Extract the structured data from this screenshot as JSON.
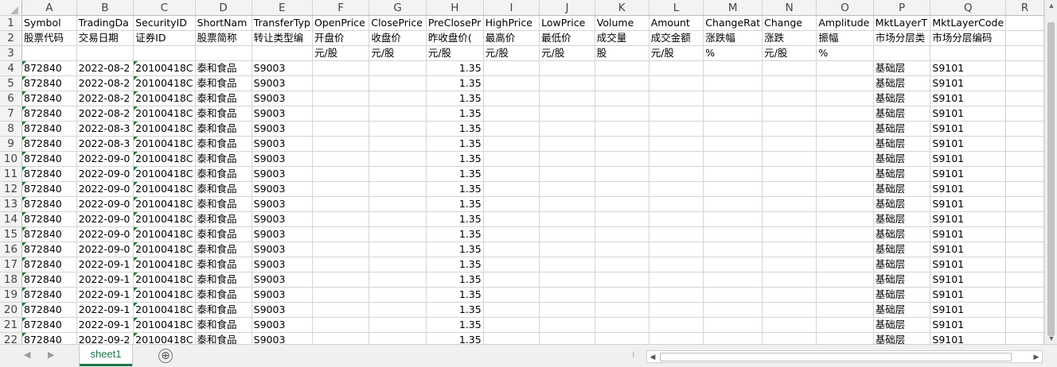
{
  "columns": [
    "A",
    "B",
    "C",
    "D",
    "E",
    "F",
    "G",
    "H",
    "I",
    "J",
    "K",
    "L",
    "M",
    "N",
    "O",
    "P",
    "Q",
    "R"
  ],
  "header_rows": [
    [
      "Symbol",
      "TradingDa",
      "SecurityID",
      "ShortNam",
      "TransferTyp",
      "OpenPrice",
      "ClosePrice",
      "PreClosePr",
      "HighPrice",
      "LowPrice",
      "Volume",
      "Amount",
      "ChangeRat",
      "Change",
      "Amplitude",
      "MktLayerT",
      "MktLayerCode",
      ""
    ],
    [
      "股票代码",
      "交易日期",
      "证券ID",
      "股票简称",
      "转让类型编",
      "开盘价",
      "收盘价",
      "昨收盘价(",
      "最高价",
      "最低价",
      "成交量",
      "成交金额",
      "涨跌幅",
      "涨跌",
      "振幅",
      "市场分层类",
      "市场分层编码",
      ""
    ],
    [
      "",
      "",
      "",
      "",
      "",
      "元/股",
      "元/股",
      "元/股",
      "元/股",
      "元/股",
      "股",
      "元/股",
      "%",
      "元/股",
      "%",
      "",
      "",
      ""
    ]
  ],
  "data_rows": [
    {
      "row": "4",
      "symbol": "872840",
      "date": "2022-08-2",
      "secid": "20100418C",
      "name": "泰和食品",
      "transfer": "S9003",
      "preclose": "1.35",
      "layer": "基础层",
      "layercode": "S9101"
    },
    {
      "row": "5",
      "symbol": "872840",
      "date": "2022-08-2",
      "secid": "20100418C",
      "name": "泰和食品",
      "transfer": "S9003",
      "preclose": "1.35",
      "layer": "基础层",
      "layercode": "S9101"
    },
    {
      "row": "6",
      "symbol": "872840",
      "date": "2022-08-2",
      "secid": "20100418C",
      "name": "泰和食品",
      "transfer": "S9003",
      "preclose": "1.35",
      "layer": "基础层",
      "layercode": "S9101"
    },
    {
      "row": "7",
      "symbol": "872840",
      "date": "2022-08-2",
      "secid": "20100418C",
      "name": "泰和食品",
      "transfer": "S9003",
      "preclose": "1.35",
      "layer": "基础层",
      "layercode": "S9101"
    },
    {
      "row": "8",
      "symbol": "872840",
      "date": "2022-08-3",
      "secid": "20100418C",
      "name": "泰和食品",
      "transfer": "S9003",
      "preclose": "1.35",
      "layer": "基础层",
      "layercode": "S9101"
    },
    {
      "row": "9",
      "symbol": "872840",
      "date": "2022-08-3",
      "secid": "20100418C",
      "name": "泰和食品",
      "transfer": "S9003",
      "preclose": "1.35",
      "layer": "基础层",
      "layercode": "S9101"
    },
    {
      "row": "10",
      "symbol": "872840",
      "date": "2022-09-0",
      "secid": "20100418C",
      "name": "泰和食品",
      "transfer": "S9003",
      "preclose": "1.35",
      "layer": "基础层",
      "layercode": "S9101"
    },
    {
      "row": "11",
      "symbol": "872840",
      "date": "2022-09-0",
      "secid": "20100418C",
      "name": "泰和食品",
      "transfer": "S9003",
      "preclose": "1.35",
      "layer": "基础层",
      "layercode": "S9101"
    },
    {
      "row": "12",
      "symbol": "872840",
      "date": "2022-09-0",
      "secid": "20100418C",
      "name": "泰和食品",
      "transfer": "S9003",
      "preclose": "1.35",
      "layer": "基础层",
      "layercode": "S9101"
    },
    {
      "row": "13",
      "symbol": "872840",
      "date": "2022-09-0",
      "secid": "20100418C",
      "name": "泰和食品",
      "transfer": "S9003",
      "preclose": "1.35",
      "layer": "基础层",
      "layercode": "S9101"
    },
    {
      "row": "14",
      "symbol": "872840",
      "date": "2022-09-0",
      "secid": "20100418C",
      "name": "泰和食品",
      "transfer": "S9003",
      "preclose": "1.35",
      "layer": "基础层",
      "layercode": "S9101"
    },
    {
      "row": "15",
      "symbol": "872840",
      "date": "2022-09-0",
      "secid": "20100418C",
      "name": "泰和食品",
      "transfer": "S9003",
      "preclose": "1.35",
      "layer": "基础层",
      "layercode": "S9101"
    },
    {
      "row": "16",
      "symbol": "872840",
      "date": "2022-09-0",
      "secid": "20100418C",
      "name": "泰和食品",
      "transfer": "S9003",
      "preclose": "1.35",
      "layer": "基础层",
      "layercode": "S9101"
    },
    {
      "row": "17",
      "symbol": "872840",
      "date": "2022-09-1",
      "secid": "20100418C",
      "name": "泰和食品",
      "transfer": "S9003",
      "preclose": "1.35",
      "layer": "基础层",
      "layercode": "S9101"
    },
    {
      "row": "18",
      "symbol": "872840",
      "date": "2022-09-1",
      "secid": "20100418C",
      "name": "泰和食品",
      "transfer": "S9003",
      "preclose": "1.35",
      "layer": "基础层",
      "layercode": "S9101"
    },
    {
      "row": "19",
      "symbol": "872840",
      "date": "2022-09-1",
      "secid": "20100418C",
      "name": "泰和食品",
      "transfer": "S9003",
      "preclose": "1.35",
      "layer": "基础层",
      "layercode": "S9101"
    },
    {
      "row": "20",
      "symbol": "872840",
      "date": "2022-09-1",
      "secid": "20100418C",
      "name": "泰和食品",
      "transfer": "S9003",
      "preclose": "1.35",
      "layer": "基础层",
      "layercode": "S9101"
    },
    {
      "row": "21",
      "symbol": "872840",
      "date": "2022-09-1",
      "secid": "20100418C",
      "name": "泰和食品",
      "transfer": "S9003",
      "preclose": "1.35",
      "layer": "基础层",
      "layercode": "S9101"
    },
    {
      "row": "22",
      "symbol": "872840",
      "date": "2022-09-2",
      "secid": "20100418C",
      "name": "泰和食品",
      "transfer": "S9003",
      "preclose": "1.35",
      "layer": "基础层",
      "layercode": "S9101"
    }
  ],
  "sheet_tabs": [
    "sheet1"
  ],
  "add_sheet_symbol": "⊕",
  "accent_color": "#217346",
  "indicator_color": "#1e7a3a"
}
